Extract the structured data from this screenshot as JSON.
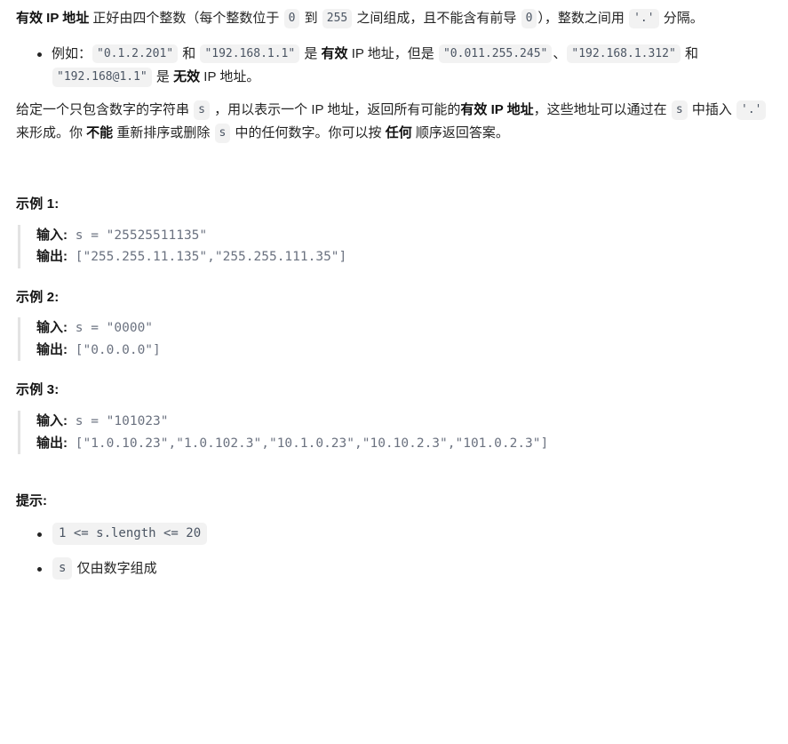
{
  "document": {
    "intro": {
      "term": "有效 IP 地址",
      "part1": " 正好由四个整数（每个整数位于 ",
      "code_zero": "0",
      "part2": " 到 ",
      "code_255": "255",
      "part3": " 之间组成，且不能含有前导 ",
      "code_zero2": "0",
      "part4": "），整数之间用 ",
      "code_dot": "'.'",
      "part5": " 分隔。"
    },
    "example_bullet": {
      "lead": "例如：",
      "code_valid1": "\"0.1.2.201\"",
      "conj1": " 和 ",
      "code_valid2": "\"192.168.1.1\"",
      "mid1": " 是 ",
      "bold_valid": "有效",
      "mid2": " IP 地址，但是 ",
      "code_invalid1": "\"0.011.255.245\"",
      "sep1": "、",
      "code_invalid2": "\"192.168.1.312\"",
      "conj2": " 和 ",
      "code_invalid3": "\"192.168@1.1\"",
      "mid3": " 是 ",
      "bold_invalid": "无效",
      "tail": " IP 地址。"
    },
    "task": {
      "p1": "给定一个只包含数字的字符串 ",
      "code_s1": "s",
      "p2": " ，用以表示一个 IP 地址，返回所有可能的",
      "bold_valid_ip": "有效 IP 地址",
      "p3": "，这些地址可以通过在 ",
      "code_s2": "s",
      "p4": " 中插入 ",
      "code_dot": "'.'",
      "p5": " 来形成。你 ",
      "bold_cannot": "不能",
      "p6": " 重新排序或删除 ",
      "code_s3": "s",
      "p7": " 中的任何数字。你可以按 ",
      "bold_any": "任何",
      "p8": " 顺序返回答案。"
    },
    "examples": [
      {
        "heading": "示例 1:",
        "input_label": "输入:",
        "input_value": " s = \"25525511135\"",
        "output_label": "输出:",
        "output_value": " [\"255.255.11.135\",\"255.255.111.35\"]"
      },
      {
        "heading": "示例 2:",
        "input_label": "输入:",
        "input_value": " s = \"0000\"",
        "output_label": "输出:",
        "output_value": " [\"0.0.0.0\"]"
      },
      {
        "heading": "示例 3:",
        "input_label": "输入:",
        "input_value": " s = \"101023\"",
        "output_label": "输出:",
        "output_value": " [\"1.0.10.23\",\"1.0.102.3\",\"10.1.0.23\",\"10.10.2.3\",\"101.0.2.3\"]"
      }
    ],
    "hints": {
      "heading": "提示:",
      "items": [
        {
          "code": "1 <= s.length <= 20",
          "text": ""
        },
        {
          "code": "s",
          "text": " 仅由数字组成"
        }
      ]
    }
  },
  "colors": {
    "text": "#242424",
    "bold": "#111111",
    "code_text": "#6b7280",
    "code_bg": "#f2f2f2",
    "quote_border": "#e3e3e3",
    "background": "#ffffff"
  }
}
